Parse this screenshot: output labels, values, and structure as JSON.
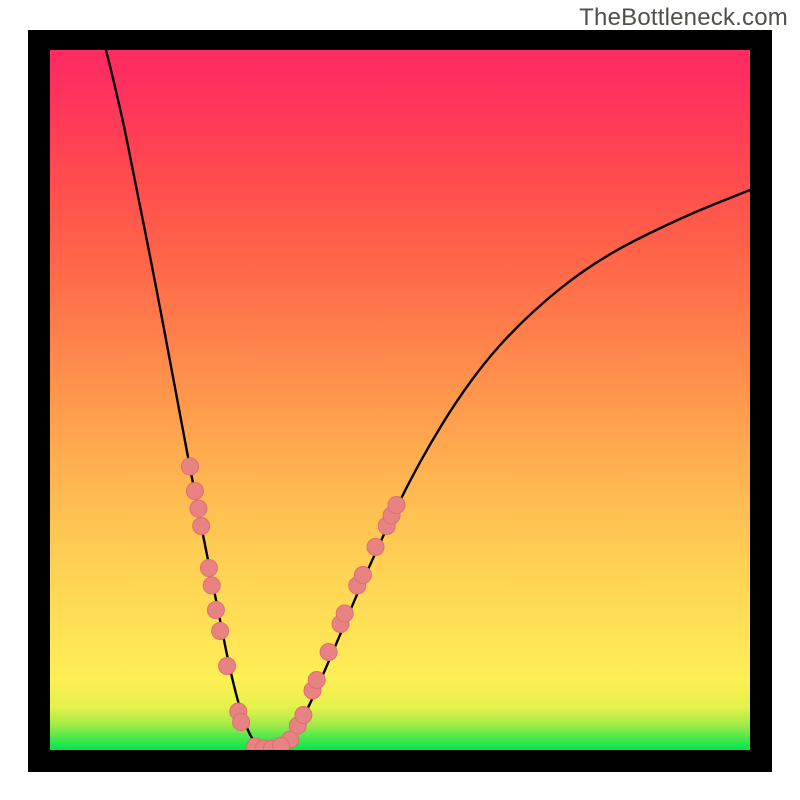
{
  "watermark_text": "TheBottleneck.com",
  "chart_data": {
    "type": "line",
    "title": "",
    "xlabel": "",
    "ylabel": "",
    "xlim": [
      0,
      100
    ],
    "ylim": [
      0,
      100
    ],
    "grid": false,
    "legend": false,
    "curve": [
      {
        "x": 8,
        "y": 100
      },
      {
        "x": 10,
        "y": 92
      },
      {
        "x": 12,
        "y": 82
      },
      {
        "x": 15,
        "y": 67
      },
      {
        "x": 18,
        "y": 51
      },
      {
        "x": 21,
        "y": 35
      },
      {
        "x": 24,
        "y": 20
      },
      {
        "x": 26,
        "y": 10
      },
      {
        "x": 28,
        "y": 3
      },
      {
        "x": 30,
        "y": 0
      },
      {
        "x": 33,
        "y": 0
      },
      {
        "x": 36,
        "y": 4
      },
      {
        "x": 40,
        "y": 13
      },
      {
        "x": 45,
        "y": 25
      },
      {
        "x": 52,
        "y": 40
      },
      {
        "x": 60,
        "y": 53
      },
      {
        "x": 68,
        "y": 62
      },
      {
        "x": 78,
        "y": 70
      },
      {
        "x": 90,
        "y": 76
      },
      {
        "x": 100,
        "y": 80
      }
    ],
    "markers_left": [
      {
        "x": 20.0,
        "y": 40.5
      },
      {
        "x": 20.7,
        "y": 37.0
      },
      {
        "x": 21.2,
        "y": 34.5
      },
      {
        "x": 21.6,
        "y": 32.0
      },
      {
        "x": 22.7,
        "y": 26.0
      },
      {
        "x": 23.1,
        "y": 23.5
      },
      {
        "x": 23.7,
        "y": 20.0
      },
      {
        "x": 24.3,
        "y": 17.0
      },
      {
        "x": 25.3,
        "y": 12.0
      },
      {
        "x": 26.9,
        "y": 5.5
      },
      {
        "x": 27.3,
        "y": 4.0
      }
    ],
    "markers_right": [
      {
        "x": 34.3,
        "y": 1.5
      },
      {
        "x": 35.4,
        "y": 3.5
      },
      {
        "x": 36.2,
        "y": 5.0
      },
      {
        "x": 37.5,
        "y": 8.5
      },
      {
        "x": 38.1,
        "y": 10.0
      },
      {
        "x": 39.8,
        "y": 14.0
      },
      {
        "x": 41.5,
        "y": 18.0
      },
      {
        "x": 42.1,
        "y": 19.5
      },
      {
        "x": 43.9,
        "y": 23.5
      },
      {
        "x": 44.7,
        "y": 25.0
      },
      {
        "x": 46.5,
        "y": 29.0
      },
      {
        "x": 48.1,
        "y": 32.0
      },
      {
        "x": 48.8,
        "y": 33.5
      },
      {
        "x": 49.5,
        "y": 35.0
      }
    ],
    "markers_bottom": [
      {
        "x": 29.3,
        "y": 0.5
      },
      {
        "x": 30.5,
        "y": 0.2
      },
      {
        "x": 31.7,
        "y": 0.2
      },
      {
        "x": 33.0,
        "y": 0.6
      }
    ],
    "colors": {
      "curve_stroke": "#000000",
      "marker_fill": "#e98383",
      "marker_stroke": "#dd6f6f",
      "frame": "#000000",
      "watermark": "#50504a",
      "gradient_top": "#ff2b63",
      "gradient_mid": "#ffc552",
      "gradient_low": "#fef055",
      "gradient_bottom": "#00e651"
    }
  }
}
